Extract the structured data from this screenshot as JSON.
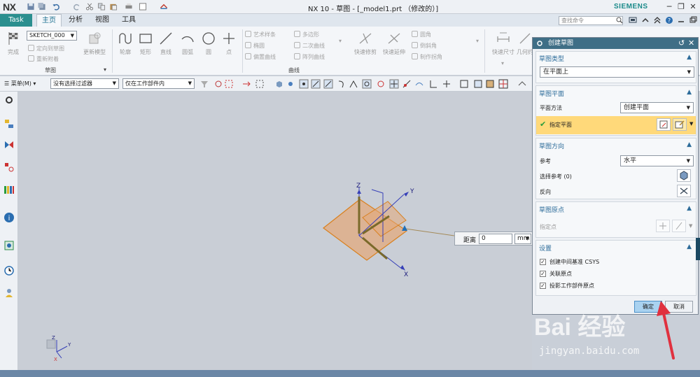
{
  "titlebar": {
    "logo": "NX",
    "title": "NX 10 - 草图 - [_model1.prt （修改的）]",
    "brand": "SIEMENS",
    "minimize": "─",
    "restore": "❐",
    "close": "✕"
  },
  "tabs": {
    "task": "Task",
    "home": "主页",
    "analysis": "分析",
    "view": "视图",
    "tools": "工具"
  },
  "search": {
    "placeholder": "查找命令"
  },
  "ribbon": {
    "sketch_name": "SKETCH_000",
    "finish": "完成",
    "orient_to_sketch": "定向到草图",
    "reattach": "重新附着",
    "update_model": "更新模型",
    "sketch_group": "草图",
    "profile": "轮廓",
    "rectangle": "矩形",
    "line": "直线",
    "arc": "圆弧",
    "circle": "圆",
    "point": "点",
    "studio_spline": "艺术样条",
    "ellipse": "椭圆",
    "offset_curve": "偏置曲线",
    "polygon": "多边形",
    "conic": "二次曲线",
    "pattern_curve": "阵列曲线",
    "quick_trim": "快速修剪",
    "quick_extend": "快速延伸",
    "fillet": "圆角",
    "chamfer": "倒斜角",
    "make_corner": "制作拐角",
    "curve_group": "曲线",
    "rapid_dimension": "快速尺寸",
    "geometric": "几何约"
  },
  "filterbar": {
    "menu": "菜单(M)",
    "type_filter": "没有选择过滤器",
    "scope": "仅在工作部件内"
  },
  "axis": {
    "z": "Z",
    "y": "Y",
    "x": "X"
  },
  "distance": {
    "label": "距离",
    "value": "0",
    "unit": "mm"
  },
  "dialog": {
    "title": "创建草图",
    "reset": "↺",
    "close": "✕",
    "type_section": "草图类型",
    "type_value": "在平面上",
    "plane_section": "草图平面",
    "plane_method_label": "平面方法",
    "plane_method_value": "创建平面",
    "specify_plane": "指定平面",
    "orient_section": "草图方向",
    "reference_label": "参考",
    "reference_value": "水平",
    "select_ref": "选择参考 (0)",
    "reverse": "反向",
    "origin_section": "草图原点",
    "specify_point": "指定点",
    "settings_section": "设置",
    "chk1": "创建中间基准 CSYS",
    "chk2": "关联原点",
    "chk3": "投影工作部件原点",
    "ok": "确定",
    "cancel": "取消"
  },
  "watermark": {
    "logo": "Bai 经验",
    "url": "jingyan.baidu.com"
  },
  "colors": {
    "plane_fill": "#e4a878",
    "plane_stroke": "#d9801e",
    "accent": "#3f6e86",
    "highlight": "#ffd97a",
    "arrow": "#e0313f"
  }
}
